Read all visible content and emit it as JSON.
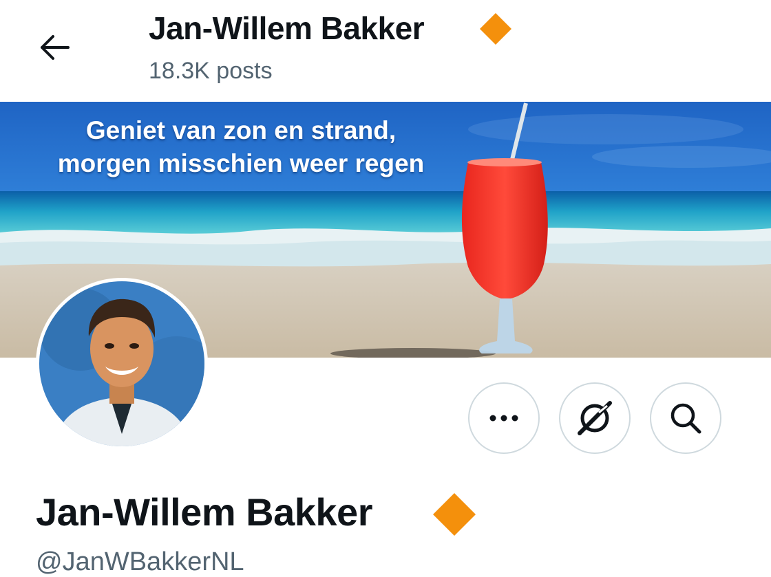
{
  "header": {
    "back_icon": "arrow-left-icon",
    "title": "Jan-Willem Bakker",
    "posts_count": "18.3K posts",
    "badge_icon": "verified-diamond-icon",
    "badge_color": "#f4900c"
  },
  "banner": {
    "line1": "Geniet van zon en strand,",
    "line2": "morgen misschien weer regen"
  },
  "actions": {
    "more_icon": "more-dots-icon",
    "grok_icon": "grok-icon",
    "search_icon": "search-icon"
  },
  "profile": {
    "display_name": "Jan-Willem Bakker",
    "handle": "@JanWBakkerNL",
    "badge_icon": "verified-diamond-icon",
    "badge_color": "#f4900c"
  }
}
